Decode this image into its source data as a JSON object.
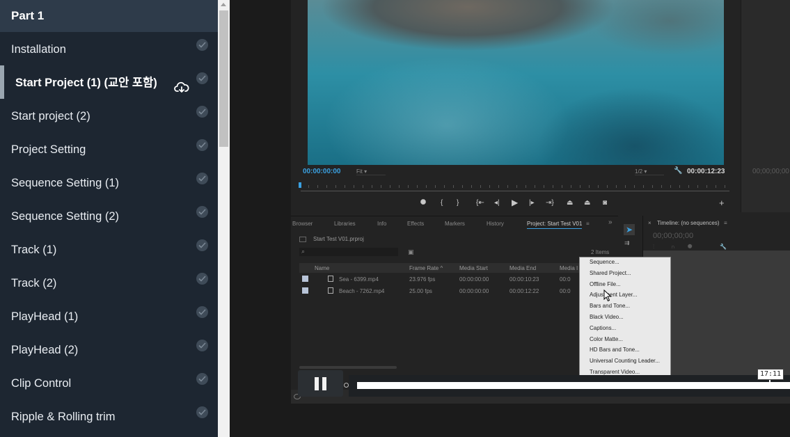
{
  "sidebar": {
    "section_title": "Part 1",
    "lessons": [
      {
        "label": "Installation"
      },
      {
        "label": "Start Project (1) (교안 포함)"
      },
      {
        "label": "Start project (2)"
      },
      {
        "label": "Project Setting"
      },
      {
        "label": "Sequence Setting (1)"
      },
      {
        "label": "Sequence Setting (2)"
      },
      {
        "label": "Track (1)"
      },
      {
        "label": "Track (2)"
      },
      {
        "label": "PlayHead (1)"
      },
      {
        "label": "PlayHead (2)"
      },
      {
        "label": "Clip Control"
      },
      {
        "label": "Ripple & Rolling trim"
      }
    ],
    "active_index": 1
  },
  "premiere": {
    "monitor": {
      "timecode_in": "00:00:00:00",
      "fit": "Fit",
      "resolution": "1/2",
      "timecode_out": "00:00:12:23",
      "source_timecode": "00;00;00;00"
    },
    "tabs": [
      "Browser",
      "Libraries",
      "Info",
      "Effects",
      "Markers",
      "History",
      "Project: Start Test V01"
    ],
    "project_file": "Start Test V01.prproj",
    "item_count": "2 Items",
    "columns": [
      "Name",
      "Frame Rate",
      "Media Start",
      "Media End",
      "Media I"
    ],
    "clips": [
      {
        "name": "Sea - 6399.mp4",
        "frame_rate": "23.976 fps",
        "media_start": "00:00:00:00",
        "media_end": "00:00:10:23",
        "extra": "00:0"
      },
      {
        "name": "Beach - 7262.mp4",
        "frame_rate": "25.00 fps",
        "media_start": "00:00:00:00",
        "media_end": "00:00:12:22",
        "extra": "00:0"
      }
    ],
    "timeline": {
      "title": "Timeline: (no sequences)",
      "timecode": "00;00;00;00"
    },
    "context_menu": [
      "Sequence...",
      "Shared Project...",
      "Offline File...",
      "Adjustment Layer...",
      "Bars and Tone...",
      "Black Video...",
      "Captions...",
      "Color Matte...",
      "HD Bars and Tone...",
      "Universal Counting Leader...",
      "Transparent Video..."
    ]
  },
  "player": {
    "time_tooltip": "17:11",
    "progress": 0.94
  }
}
